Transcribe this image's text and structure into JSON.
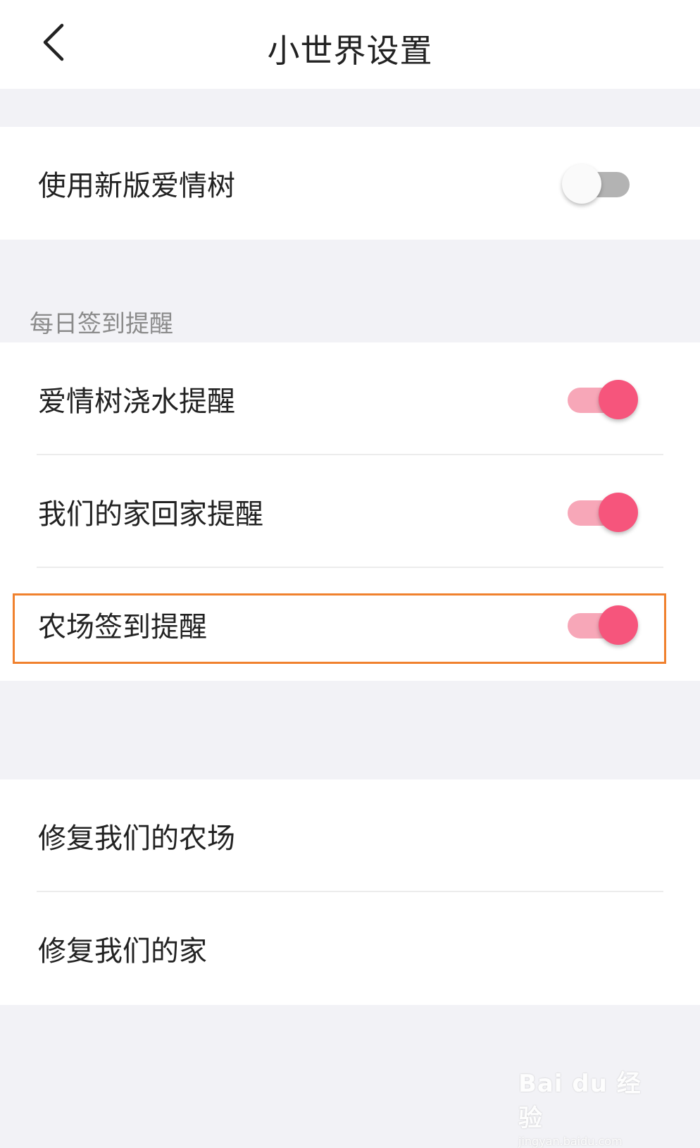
{
  "header": {
    "back_icon": "chevron-left-icon",
    "title": "小世界设置"
  },
  "top_section": {
    "items": [
      {
        "label": "使用新版爱情树",
        "toggle": "off"
      }
    ]
  },
  "reminders": {
    "group_label": "每日签到提醒",
    "items": [
      {
        "label": "爱情树浇水提醒",
        "toggle": "on"
      },
      {
        "label": "我们的家回家提醒",
        "toggle": "on"
      },
      {
        "label": "农场签到提醒",
        "toggle": "on"
      }
    ]
  },
  "repair_section": {
    "items": [
      {
        "label": "修复我们的农场"
      },
      {
        "label": "修复我们的家"
      }
    ]
  },
  "watermark": {
    "main": "Bai du 经验",
    "sub": "jingyan.baidu.com"
  },
  "colors": {
    "accent": "#f6557c",
    "accent_track": "#f7a7b8",
    "highlight_border": "#f0812e",
    "background": "#f2f2f6"
  }
}
